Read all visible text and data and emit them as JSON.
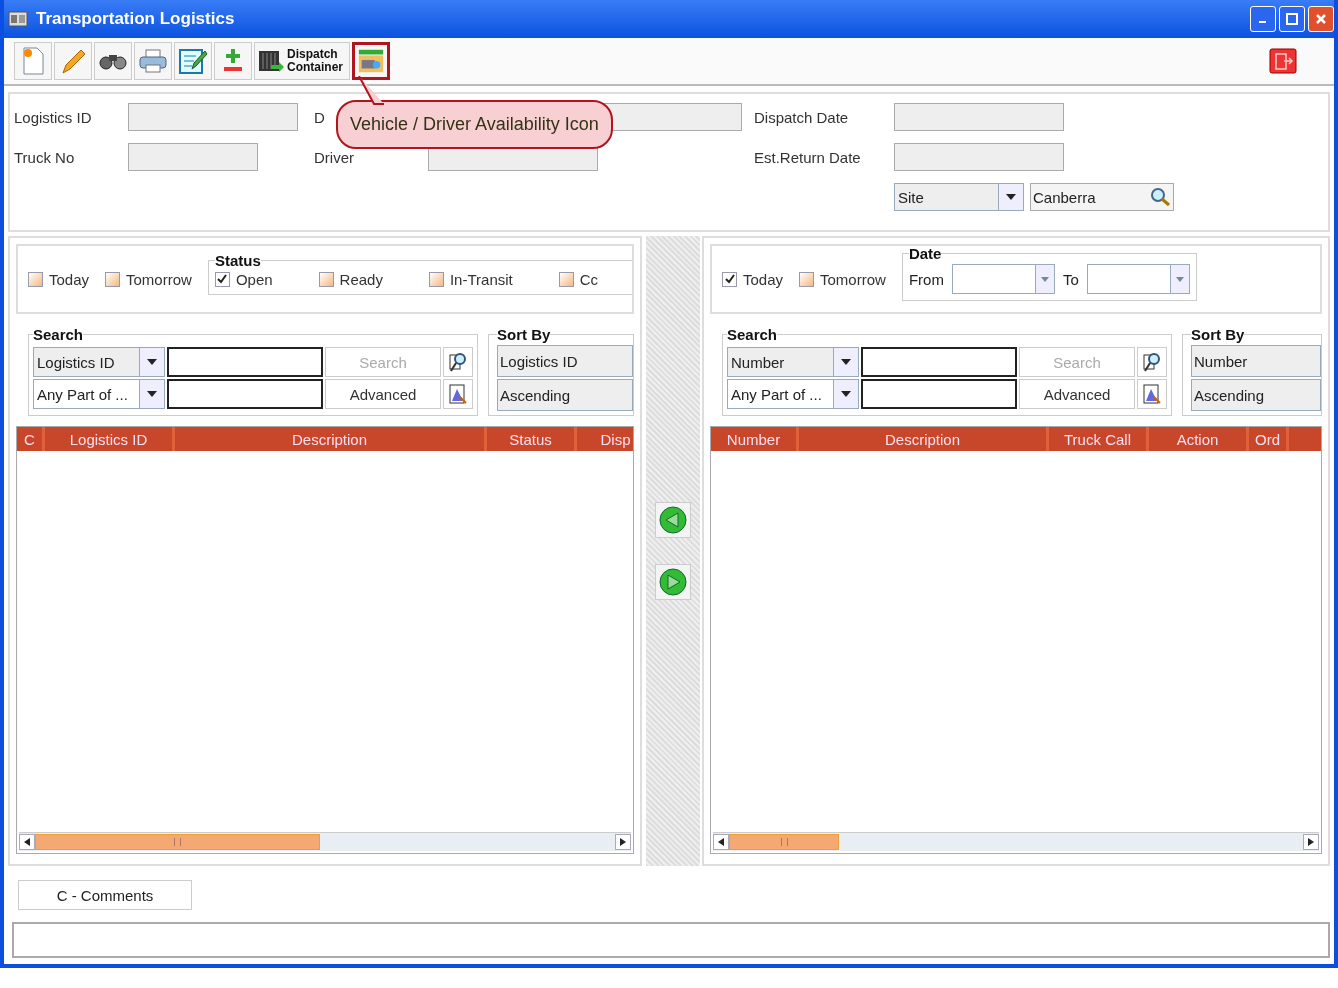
{
  "window": {
    "title": "Transportation Logistics"
  },
  "toolbar": {
    "buttons": [
      {
        "kind": "new",
        "highlighted": false
      },
      {
        "kind": "edit",
        "highlighted": false
      },
      {
        "kind": "find",
        "highlighted": false
      },
      {
        "kind": "print",
        "highlighted": false
      },
      {
        "kind": "notes",
        "highlighted": false
      },
      {
        "kind": "add_remove",
        "highlighted": false
      },
      {
        "kind": "dispatch",
        "label": "Dispatch Container",
        "highlighted": false
      },
      {
        "kind": "availability",
        "highlighted": true
      }
    ]
  },
  "callout": "Vehicle / Driver Availability Icon",
  "header": {
    "left": [
      {
        "label": "Logistics ID"
      },
      {
        "label": "Truck No"
      }
    ],
    "middle": [
      {
        "label": "D"
      },
      {
        "label": "Driver"
      }
    ],
    "right": [
      {
        "label": "Dispatch Date"
      },
      {
        "label": "Est.Return Date"
      }
    ],
    "site": {
      "value": "Site",
      "location": "Canberra"
    }
  },
  "left_panel": {
    "quick": [
      {
        "label": "Today",
        "checked": false
      },
      {
        "label": "Tomorrow",
        "checked": false
      }
    ],
    "status": {
      "title": "Status",
      "items": [
        {
          "label": "Open",
          "checked": true
        },
        {
          "label": "Ready",
          "checked": false
        },
        {
          "label": "In-Transit",
          "checked": false
        },
        {
          "label": "Cc",
          "checked": false
        }
      ]
    },
    "search": {
      "title": "Search",
      "field": "Logistics ID",
      "match": "Any Part of ...",
      "search_button": "Search",
      "advanced_button": "Advanced"
    },
    "sort": {
      "title": "Sort By",
      "field": "Logistics ID",
      "order": "Ascending"
    },
    "columns": [
      "C",
      "Logistics ID",
      "Description",
      "Status",
      "Disp"
    ]
  },
  "right_panel": {
    "quick": [
      {
        "label": "Today",
        "checked": true
      },
      {
        "label": "Tomorrow",
        "checked": false
      }
    ],
    "date": {
      "title": "Date",
      "from": "From",
      "to": "To"
    },
    "search": {
      "title": "Search",
      "field": "Number",
      "match": "Any Part of ...",
      "search_button": "Search",
      "advanced_button": "Advanced"
    },
    "sort": {
      "title": "Sort By",
      "field": "Number",
      "order": "Ascending"
    },
    "columns": [
      "Number",
      "Description",
      "Truck Call",
      "Action",
      "Ord"
    ]
  },
  "footer": {
    "comments": "C - Comments"
  }
}
